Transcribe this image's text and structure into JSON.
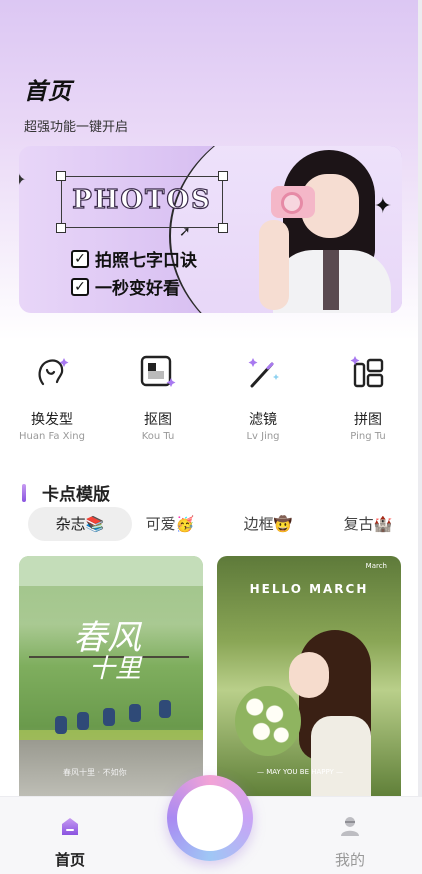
{
  "header": {
    "title": "首页",
    "subtitle": "超强功能一键开启"
  },
  "banner": {
    "photos_text": "PHOTOS",
    "line1": "拍照七字口诀",
    "line2": "一秒变好看",
    "check_mark": "✓"
  },
  "features": [
    {
      "label": "换发型",
      "sub": "Huan Fa Xing",
      "icon": "hairstyle-icon"
    },
    {
      "label": "抠图",
      "sub": "Kou Tu",
      "icon": "cutout-icon"
    },
    {
      "label": "滤镜",
      "sub": "Lv Jing",
      "icon": "filter-wand-icon"
    },
    {
      "label": "拼图",
      "sub": "Ping Tu",
      "icon": "collage-icon"
    }
  ],
  "section": {
    "title": "卡点模版"
  },
  "tags": [
    {
      "label": "杂志📚",
      "active": true
    },
    {
      "label": "可爱🥳",
      "active": false
    },
    {
      "label": "边框🤠",
      "active": false
    },
    {
      "label": "复古🏰",
      "active": false
    }
  ],
  "cards": [
    {
      "calligraphy_1": "春风",
      "calligraphy_2": "十里",
      "caption": "春风十里 · 不如你"
    },
    {
      "title": "HELLO MARCH",
      "top_tag": "March",
      "caption": "— MAY YOU BE HAPPY —"
    }
  ],
  "tabbar": {
    "home_label": "首页",
    "mine_label": "我的"
  },
  "colors": {
    "accent": "#8a54e0",
    "bg_top": "#dcc7f3",
    "tabbar_bg": "#f7f7f9"
  }
}
